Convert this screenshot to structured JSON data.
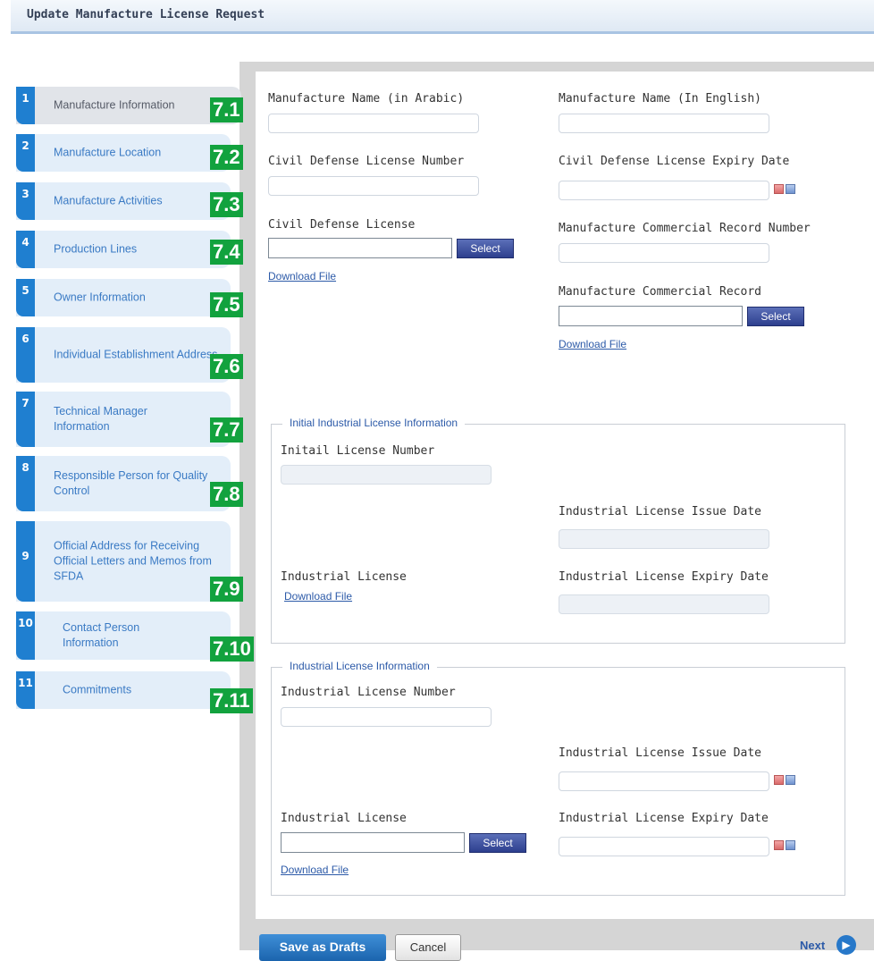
{
  "window": {
    "title": "Update Manufacture License Request"
  },
  "steps": [
    {
      "num": "1",
      "label": "Manufacture Information",
      "badge": "7.1"
    },
    {
      "num": "2",
      "label": "Manufacture Location",
      "badge": "7.2"
    },
    {
      "num": "3",
      "label": "Manufacture Activities",
      "badge": "7.3"
    },
    {
      "num": "4",
      "label": "Production Lines",
      "badge": "7.4"
    },
    {
      "num": "5",
      "label": "Owner Information",
      "badge": "7.5"
    },
    {
      "num": "6",
      "label": "Individual Establishment Address",
      "badge": "7.6"
    },
    {
      "num": "7",
      "label": "Technical Manager Information",
      "badge": "7.7"
    },
    {
      "num": "8",
      "label": "Responsible Person for Quality Control",
      "badge": "7.8"
    },
    {
      "num": "9",
      "label": "Official Address for Receiving Official Letters and Memos from SFDA",
      "badge": "7.9"
    },
    {
      "num": "10",
      "label": "Contact Person Information",
      "badge": "7.10"
    },
    {
      "num": "11",
      "label": "Commitments",
      "badge": "7.11"
    }
  ],
  "form": {
    "name_ar_label": "Manufacture Name (in Arabic)",
    "name_en_label": "Manufacture Name (In English)",
    "cd_number_label": "Civil Defense License Number",
    "cd_expiry_label": "Civil Defense License Expiry Date",
    "cd_license_label": "Civil Defense License",
    "cr_number_label": "Manufacture Commercial Record Number",
    "cr_label": "Manufacture Commercial Record",
    "select_label": "Select",
    "download_label": "Download File"
  },
  "initial_section": {
    "legend": "Initial Industrial License Information",
    "license_number_label": "Initail License Number",
    "issue_date_label": "Industrial License Issue Date",
    "license_label": "Industrial License",
    "expiry_label": "Industrial License Expiry Date",
    "download_label": "Download File"
  },
  "industrial_section": {
    "legend": "Industrial License Information",
    "license_number_label": "Industrial License Number",
    "issue_date_label": "Industrial License Issue Date",
    "license_label": "Industrial License",
    "expiry_label": "Industrial License Expiry Date",
    "select_label": "Select",
    "download_label": "Download File"
  },
  "footer": {
    "save_draft": "Save as Drafts",
    "cancel": "Cancel",
    "next": "Next"
  }
}
